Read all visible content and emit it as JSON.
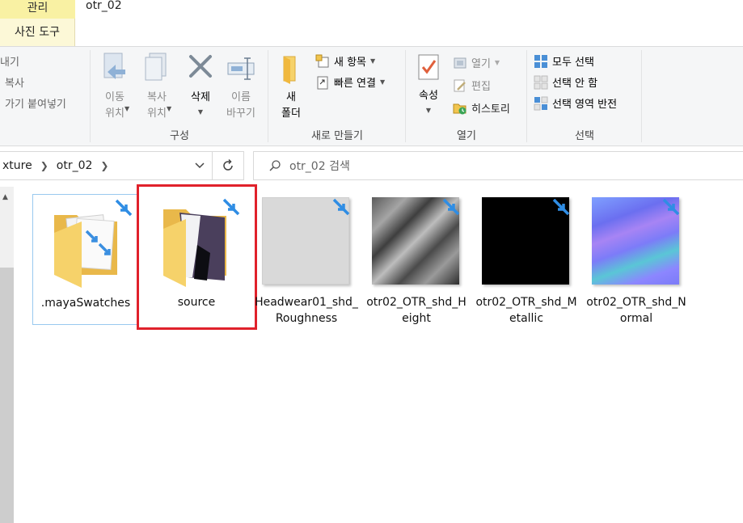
{
  "window": {
    "context_tab": "관리",
    "context_subtab": "사진 도구",
    "folder_title": "otr_02"
  },
  "ribbon": {
    "clipboard_partial": {
      "item1": "내기",
      "item2": "복사",
      "item3": "가기 붙여넣기"
    },
    "organize": {
      "move_to": "이동\n위치",
      "copy_to": "복사\n위치",
      "delete": "삭제",
      "rename": "이름\n바꾸기",
      "group_label": "구성"
    },
    "new": {
      "new_folder": "새\n폴더",
      "new_item": "새 항목",
      "easy_access": "빠른 연결",
      "group_label": "새로 만들기"
    },
    "open": {
      "properties": "속성",
      "open": "열기",
      "edit": "편집",
      "history": "히스토리",
      "group_label": "열기"
    },
    "select": {
      "select_all": "모두 선택",
      "select_none": "선택 안 함",
      "invert": "선택 영역 반전",
      "group_label": "선택"
    }
  },
  "address": {
    "crumbs": [
      "xture",
      "otr_02"
    ],
    "search_placeholder": "otr_02 검색"
  },
  "files": [
    {
      "name": ".mayaSwatches",
      "kind": "folder"
    },
    {
      "name": "source",
      "kind": "folder"
    },
    {
      "name": "Headwear01_shd_Roughness",
      "kind": "texture"
    },
    {
      "name": "otr02_OTR_shd_Height",
      "kind": "texture"
    },
    {
      "name": "otr02_OTR_shd_Metallic",
      "kind": "texture"
    },
    {
      "name": "otr02_OTR_shd_Normal",
      "kind": "texture"
    }
  ],
  "colors": {
    "context_tab": "#f9f1a3",
    "highlight_box": "#e0212b",
    "selection_border": "#99c9ef",
    "folder_yellow": "#f6d26a"
  }
}
